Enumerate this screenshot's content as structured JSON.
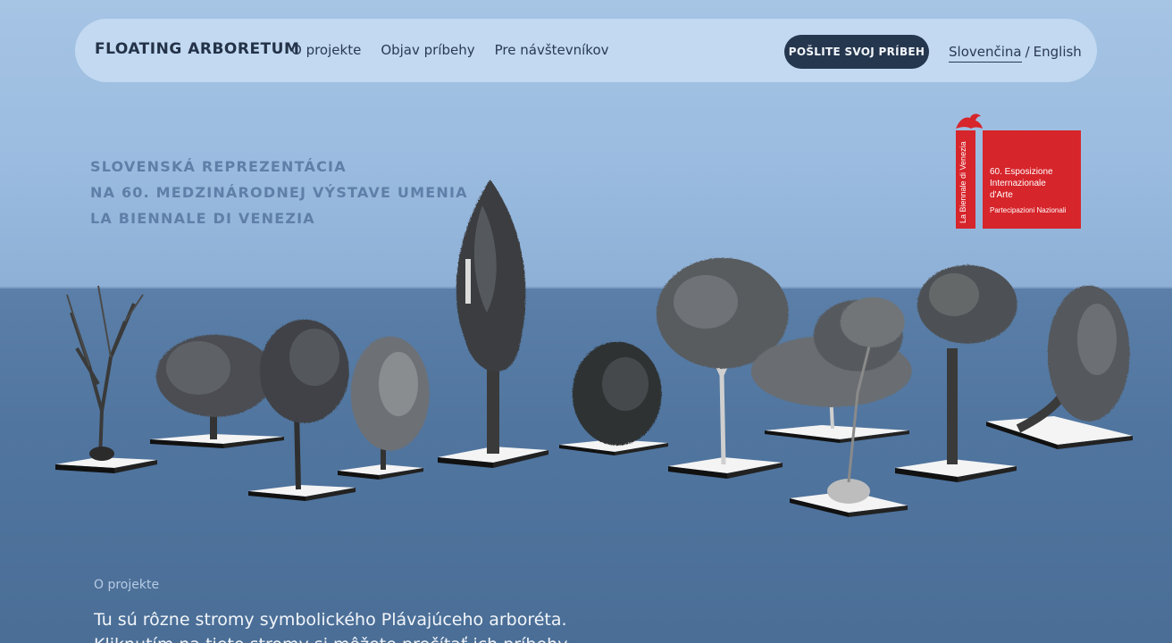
{
  "nav": {
    "brand": "FLOATING ARBORETUM",
    "menu": [
      {
        "label": "O projekte"
      },
      {
        "label": "Objav príbehy"
      },
      {
        "label": "Pre návštevníkov"
      }
    ],
    "cta": "POŠLITE SVOJ PRÍBEH",
    "lang_active": "Slovenčina",
    "lang_separator": "/",
    "lang_other": "English"
  },
  "tagline": [
    "SLOVENSKÁ REPREZENTÁCIA",
    "NA 60. MEDZINÁRODNEJ VÝSTAVE UMENIA",
    "LA BIENNALE DI VENEZIA"
  ],
  "biennale": {
    "vertical": "La Biennale di Venezia",
    "line1": "60. Esposizione",
    "line2": "Internazionale",
    "line3": "d'Arte",
    "line4": "Partecipazioni Nazionali"
  },
  "main": {
    "section_label": "O projekte",
    "intro_line1": "Tu sú rôzne stromy symbolického Plávajúceho arboréta.",
    "intro_line2": "Kliknutím na tieto stromy si môžete prečítať ich príbehy."
  },
  "colors": {
    "accent": "#25374e",
    "biennale_red": "#d6252b",
    "sky": "#9bbce0",
    "sea": "#50759f"
  }
}
